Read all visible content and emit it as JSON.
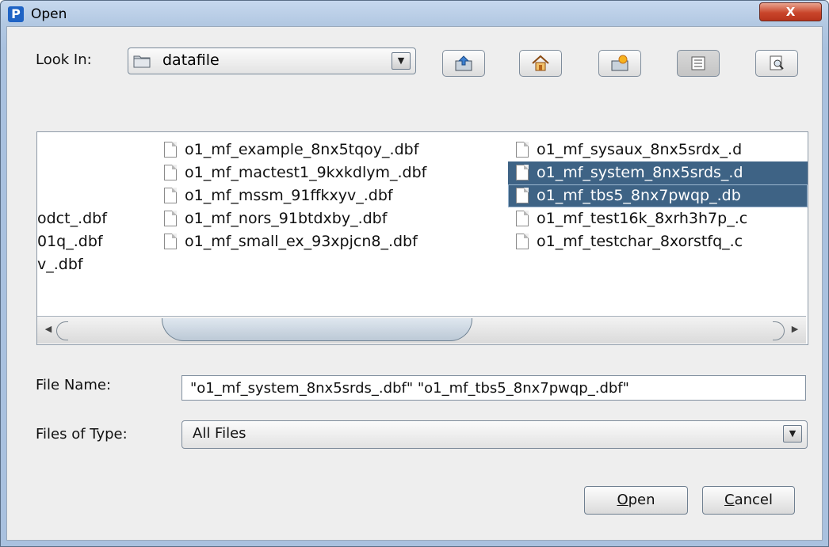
{
  "window": {
    "title": "Open",
    "app_icon_letter": "P",
    "close_label": "X"
  },
  "toolbar": {
    "look_in_label": "Look In:",
    "look_in_value": "datafile",
    "buttons": [
      "up-one-level",
      "home",
      "new-folder",
      "list-view",
      "details-view"
    ]
  },
  "file_list": {
    "col1": [
      "odct_.dbf",
      "01q_.dbf",
      "v_.dbf"
    ],
    "col2": [
      "o1_mf_example_8nx5tqoy_.dbf",
      "o1_mf_mactest1_9kxkdlym_.dbf",
      "o1_mf_mssm_91ffkxyv_.dbf",
      "o1_mf_nors_91btdxby_.dbf",
      "o1_mf_small_ex_93xpjcn8_.dbf"
    ],
    "col3": [
      "o1_mf_sysaux_8nx5srdx_.d",
      "o1_mf_system_8nx5srds_.d",
      "o1_mf_tbs5_8nx7pwqp_.db",
      "o1_mf_test16k_8xrh3h7p_.c",
      "o1_mf_testchar_8xorstfq_.c"
    ],
    "selected": [
      "o1_mf_system_8nx5srds_.dbf",
      "o1_mf_tbs5_8nx7pwqp_.dbf"
    ]
  },
  "file_name": {
    "label": "File Name:",
    "value": "\"o1_mf_system_8nx5srds_.dbf\" \"o1_mf_tbs5_8nx7pwqp_.dbf\""
  },
  "file_type": {
    "label": "Files of Type:",
    "value": "All Files"
  },
  "actions": {
    "open_mnemonic": "O",
    "open_rest": "pen",
    "cancel_mnemonic": "C",
    "cancel_rest": "ancel"
  },
  "colors": {
    "selection": "#3e6385",
    "close_button": "#c9452b",
    "frame": "#a9c1df"
  }
}
